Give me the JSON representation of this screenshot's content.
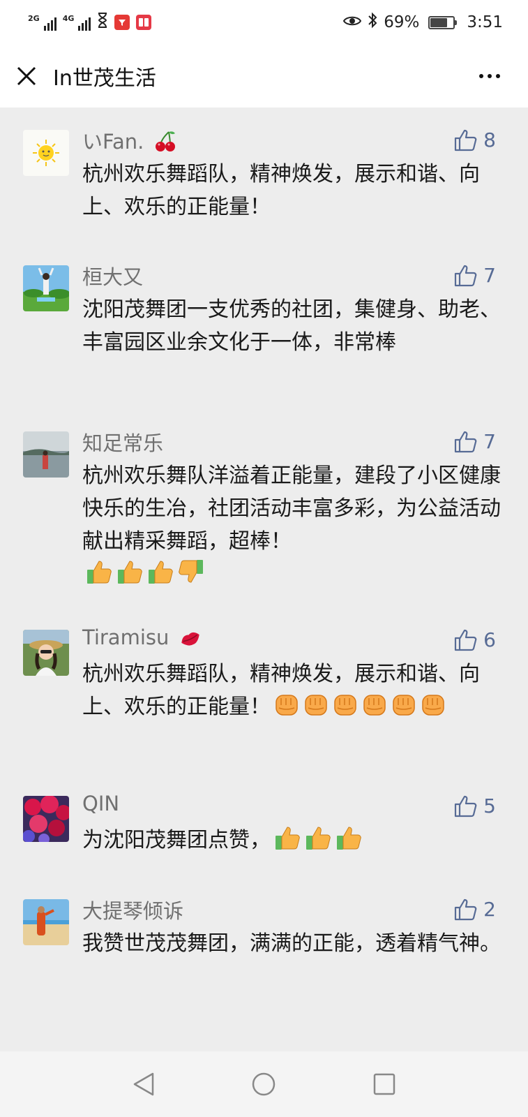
{
  "status_bar": {
    "network_1": "2G",
    "network_2": "4G",
    "battery_percent": "69%",
    "battery_level": 0.69,
    "time": "3:51"
  },
  "title_bar": {
    "title": "In世茂生活"
  },
  "comments": [
    {
      "nickname": "いFan.",
      "nickname_emoji": "cherries",
      "likes": "8",
      "text": "杭州欢乐舞蹈队，精神焕发，展示和谐、向上、欢乐的正能量！"
    },
    {
      "nickname": "桓大又",
      "likes": "7",
      "text": "沈阳茂舞团一支优秀的社团，集健身、助老、丰富园区业余文化于一体，非常棒"
    },
    {
      "nickname": "知足常乐",
      "likes": "7",
      "text": "杭州欢乐舞队洋溢着正能量，建段了小区健康快乐的生冶，社团活动丰富多彩，为公益活动献出精采舞蹈，超棒！",
      "emojis": [
        "thumbs-up",
        "thumbs-up",
        "thumbs-up",
        "thumbs-down"
      ]
    },
    {
      "nickname": "Tiramisu",
      "nickname_emoji": "kiss-lips",
      "likes": "6",
      "text": "杭州欢乐舞蹈队，精神焕发，展示和谐、向上、欢乐的正能量！",
      "emojis": [
        "fist",
        "fist",
        "fist",
        "fist",
        "fist",
        "fist"
      ]
    },
    {
      "nickname": "QIN",
      "likes": "5",
      "text": "为沈阳茂舞团点赞，",
      "emojis": [
        "thumbs-up",
        "thumbs-up",
        "thumbs-up"
      ]
    },
    {
      "nickname": "大提琴倾诉",
      "likes": "2",
      "text": "我赞世茂茂舞团，满满的正能，透着精气神。"
    }
  ],
  "colors": {
    "link": "#576b95",
    "background": "#ededed",
    "nickname": "#707070"
  }
}
